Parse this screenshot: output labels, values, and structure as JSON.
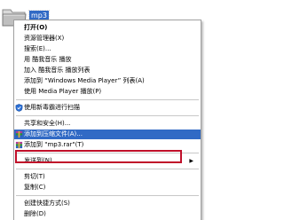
{
  "desktop": {
    "folder_name": "mp3"
  },
  "context_menu": {
    "items": [
      {
        "label": "打开(O)",
        "bold": true
      },
      {
        "label": "资源管理器(X)"
      },
      {
        "label": "搜索(E)..."
      },
      {
        "label": "用 酷我音乐 播放"
      },
      {
        "label": "加入 酷我音乐 播放列表"
      },
      {
        "label": "添加到 “Windows Media Player” 列表(A)"
      },
      {
        "label": "使用 Media Player 播放(P)"
      },
      {
        "label": "使用新毒霸进行扫描"
      },
      {
        "label": "共享和安全(H)..."
      },
      {
        "label": "添加到压缩文件(A)..."
      },
      {
        "label": "添加到 \"mp3.rar\"(T)"
      },
      {
        "label": "发送到(N)"
      },
      {
        "label": "剪切(T)"
      },
      {
        "label": "复制(C)"
      },
      {
        "label": "创建快捷方式(S)"
      },
      {
        "label": "删除(D)"
      }
    ],
    "submenu_arrow": "▶",
    "highlight_color": "#c0102a",
    "selection_color": "#316ac5"
  },
  "icons": {
    "folder": "folder-icon",
    "antivirus": "shield-icon",
    "archive_add": "winrar-archive-icon",
    "archive_add_rar": "winrar-archive-icon"
  }
}
